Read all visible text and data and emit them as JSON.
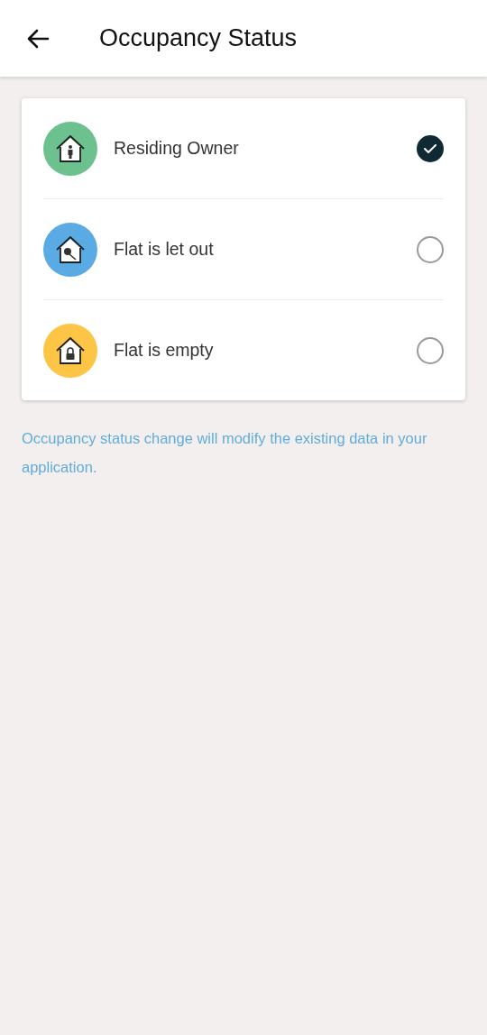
{
  "header": {
    "title": "Occupancy Status"
  },
  "options": [
    {
      "label": "Residing Owner",
      "kind": "person",
      "color": "#6cc18e",
      "selected": true
    },
    {
      "label": "Flat is let out",
      "kind": "key",
      "color": "#5aaae4",
      "selected": false
    },
    {
      "label": "Flat is empty",
      "kind": "lock",
      "color": "#fcc545",
      "selected": false
    }
  ],
  "note": "Occupancy status change will modify the existing data in your application."
}
